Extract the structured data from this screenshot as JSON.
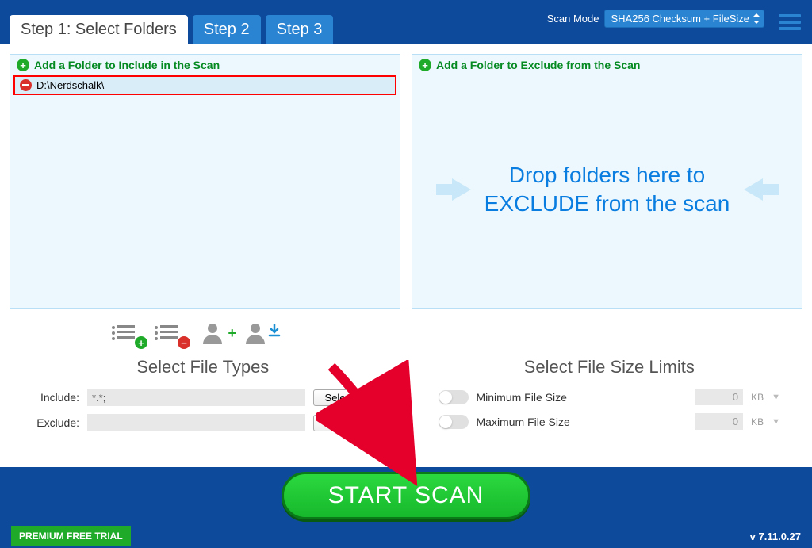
{
  "tabs": {
    "step1": "Step 1: Select Folders",
    "step2": "Step 2",
    "step3": "Step 3"
  },
  "scan_mode": {
    "label": "Scan Mode",
    "value": "SHA256 Checksum + FileSize"
  },
  "include_panel": {
    "add_label": "Add a Folder to Include in the Scan",
    "folders": [
      "D:\\Nerdschalk\\"
    ]
  },
  "exclude_panel": {
    "add_label": "Add a Folder to Exclude from the Scan",
    "drop_text": "Drop folders here to EXCLUDE from the scan"
  },
  "file_types": {
    "title": "Select File Types",
    "include_label": "Include:",
    "include_value": "*.*;",
    "exclude_label": "Exclude:",
    "exclude_value": "",
    "select_btn": "Select..."
  },
  "size_limits": {
    "title": "Select File Size Limits",
    "min_label": "Minimum File Size",
    "max_label": "Maximum File Size",
    "min_value": "0",
    "max_value": "0",
    "unit": "KB"
  },
  "start_button": "START SCAN",
  "footer": {
    "trial": "PREMIUM FREE TRIAL",
    "version": "v 7.11.0.27"
  }
}
